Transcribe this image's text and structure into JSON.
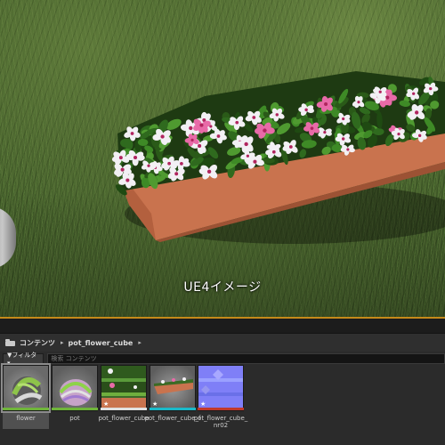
{
  "viewport": {
    "caption": "UE4イメージ"
  },
  "browser": {
    "path": {
      "root_label": "コンテンツ",
      "folder_label": "pot_flower_cube",
      "separator_glyph": "▸"
    },
    "filter_label": "▼フィルタ▾",
    "search_placeholder": "検索 コンテンツ",
    "assets": [
      {
        "name": "flower",
        "bar_color": "#6fb53a",
        "selected": true
      },
      {
        "name": "pot",
        "bar_color": "#6fb53a",
        "selected": false
      },
      {
        "name": "pot_flower_cube",
        "bar_color": "#e0e0e0",
        "selected": false
      },
      {
        "name": "pot_flower_cube_f",
        "bar_color": "#1ab9c9",
        "selected": false
      },
      {
        "name": "pot_flower_cube_nr02",
        "bar_color": "#c0392b",
        "selected": false
      }
    ]
  },
  "colors": {
    "viewport_border": "#c58a1a",
    "pot_terracotta": "#c9734e",
    "petal_white": "#f2f0f4",
    "petal_pink": "#e86aa8",
    "normal_map": "#7f7ff7"
  }
}
